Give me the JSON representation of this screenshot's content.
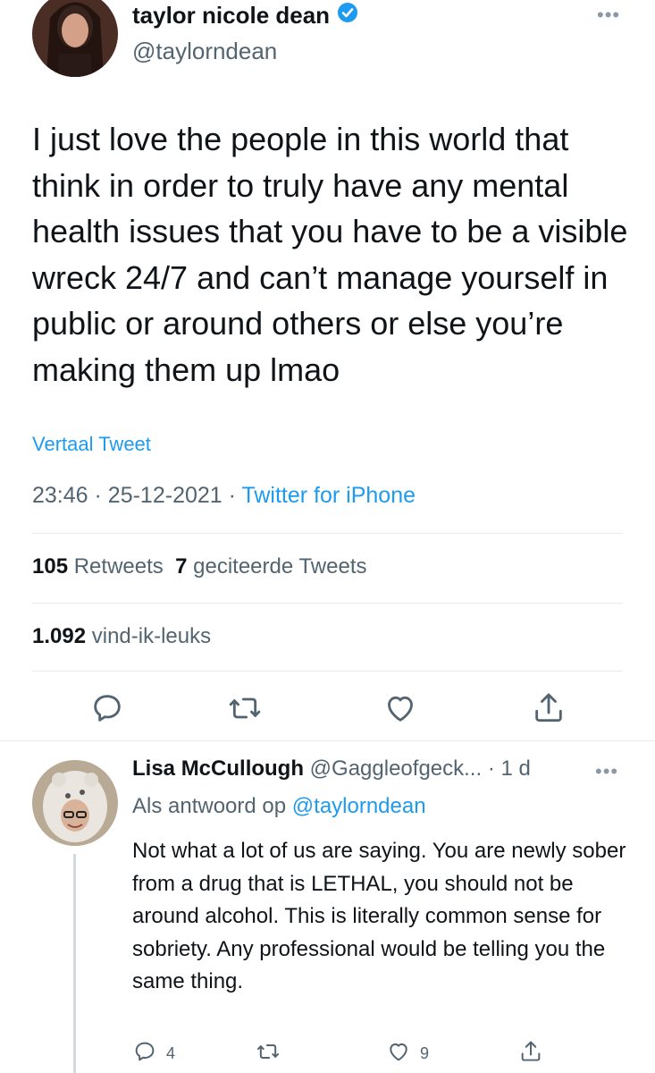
{
  "tweet": {
    "author_name": "taylor nicole dean",
    "author_handle": "@taylorndean",
    "verified_icon": "verified-badge-icon",
    "more_icon": "more-icon",
    "text": "I just love the people in this world that think in order to truly have any mental health issues that you have to be a visible wreck 24/7 and can’t manage yourself in public or around others or else you’re making them up lmao",
    "translate_label": "Vertaal Tweet",
    "time": "23:46",
    "date": "25-12-2021",
    "source": "Twitter for iPhone",
    "retweets_count": "105",
    "retweets_label": "Retweets",
    "quotes_count": "7",
    "quotes_label": "geciteerde Tweets",
    "likes_count": "1.092",
    "likes_label": "vind-ik-leuks"
  },
  "actions": [
    "reply-icon",
    "retweet-icon",
    "like-icon",
    "share-icon"
  ],
  "reply": {
    "author_name": "Lisa McCullough",
    "author_handle": "@Gaggleofgeck...",
    "age": "· 1 d",
    "replying_prefix": "Als antwoord op",
    "replying_to": "@taylorndean",
    "text": "Not what a lot of us are saying. You are newly sober from a drug that is LETHAL, you should not be around alcohol. This is literally common sense for sobriety. Any professional would be telling you the same thing.",
    "reply_count": "4",
    "like_count": "9"
  },
  "colors": {
    "accent": "#1d9bf0",
    "secondary_text": "#536471",
    "primary_text": "#0f1419",
    "divider": "#e6ecf0"
  }
}
